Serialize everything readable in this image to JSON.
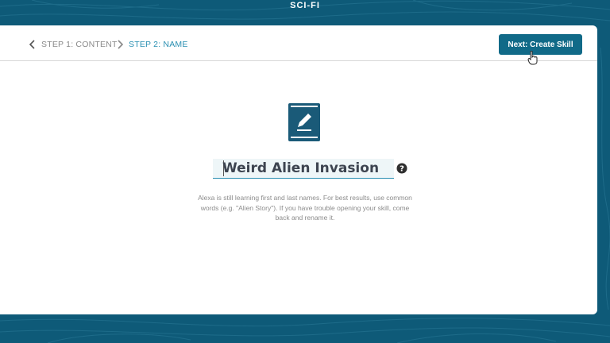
{
  "header": {
    "title": "SCI-FI"
  },
  "breadcrumb": {
    "step1": "STEP 1: CONTENT",
    "step2": "STEP 2: NAME"
  },
  "actions": {
    "next_label": "Next: Create Skill"
  },
  "skill": {
    "icon": "book-edit-icon",
    "name_value": "Weird Alien Invasion",
    "help_icon": "question-circle-icon"
  },
  "help_text": "Alexa is still learning first and last names. For best results, use common words (e.g. \"Alien Story\"). If you have trouble opening your skill, come back and rename it.",
  "colors": {
    "page_bg": "#0e5a78",
    "accent": "#2a8fb2",
    "button_bg": "#116a88",
    "icon_bg": "#1a5a78"
  }
}
